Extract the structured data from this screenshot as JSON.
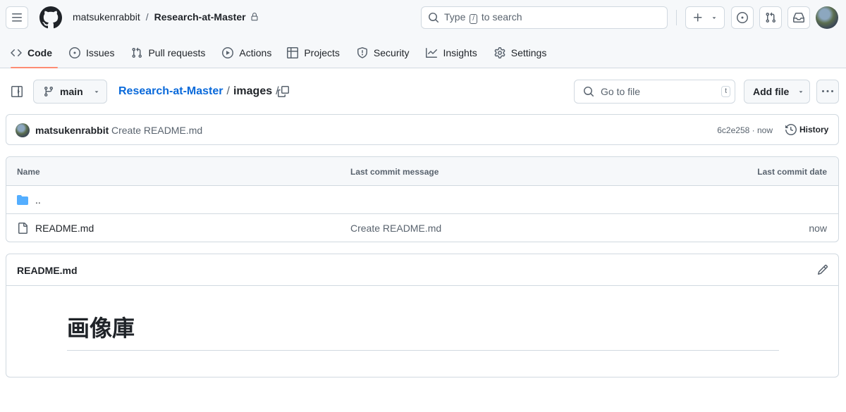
{
  "header": {
    "owner": "matsukenrabbit",
    "separator": "/",
    "repo": "Research-at-Master",
    "search": {
      "prefix": "Type",
      "key": "/",
      "suffix": "to search"
    }
  },
  "nav": {
    "items": [
      {
        "label": "Code",
        "icon": "code-icon"
      },
      {
        "label": "Issues",
        "icon": "issue-opened-icon"
      },
      {
        "label": "Pull requests",
        "icon": "git-pull-request-icon"
      },
      {
        "label": "Actions",
        "icon": "play-icon"
      },
      {
        "label": "Projects",
        "icon": "table-icon"
      },
      {
        "label": "Security",
        "icon": "shield-icon"
      },
      {
        "label": "Insights",
        "icon": "graph-icon"
      },
      {
        "label": "Settings",
        "icon": "gear-icon"
      }
    ]
  },
  "toolbar": {
    "branch": "main",
    "path_repo": "Research-at-Master",
    "path_sep": "/",
    "path_current": "images",
    "path_trailing": "/",
    "goto_placeholder": "Go to file",
    "goto_key": "t",
    "add_file": "Add file"
  },
  "commit": {
    "author": "matsukenrabbit",
    "message": "Create README.md",
    "sha": "6c2e258",
    "time": "now",
    "history_label": "History"
  },
  "table": {
    "headers": {
      "name": "Name",
      "message": "Last commit message",
      "date": "Last commit date"
    },
    "rows": [
      {
        "name": "..",
        "type": "parent-directory",
        "message": "",
        "date": ""
      },
      {
        "name": "README.md",
        "type": "file",
        "message": "Create README.md",
        "date": "now"
      }
    ]
  },
  "readme": {
    "title": "README.md",
    "heading": "画像庫"
  },
  "colors": {
    "accent_link": "#0969da",
    "folder": "#54aeff",
    "nav_underline": "#fd8c73",
    "border": "#d1d9e0",
    "muted": "#59636e"
  }
}
